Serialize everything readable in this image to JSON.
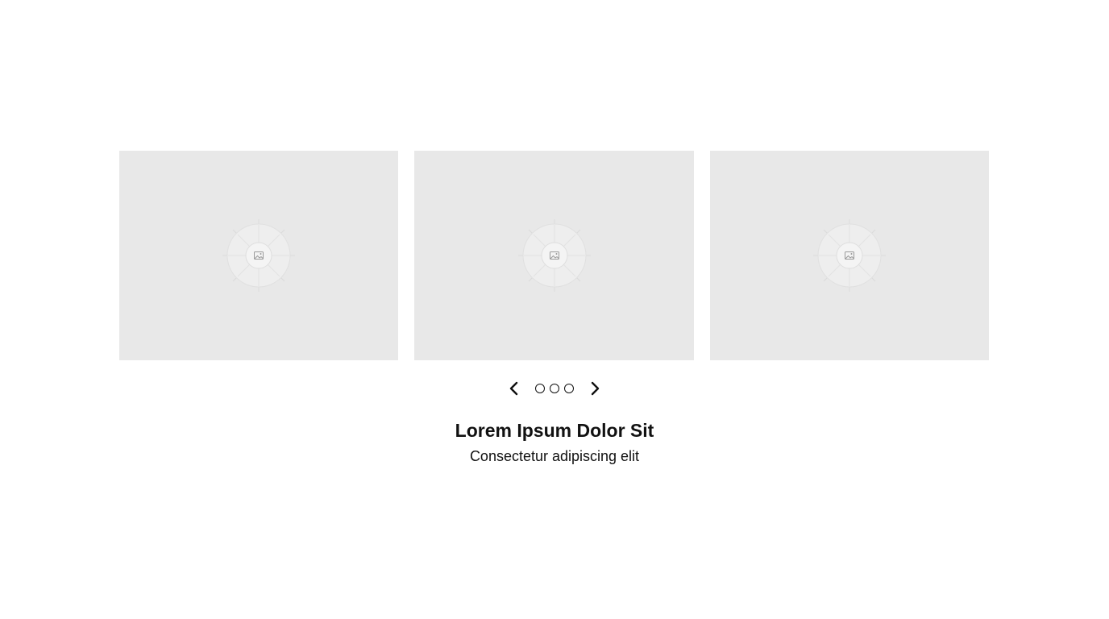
{
  "carousel": {
    "slides": [
      {
        "icon": "image-placeholder-icon"
      },
      {
        "icon": "image-placeholder-icon"
      },
      {
        "icon": "image-placeholder-icon"
      }
    ],
    "controls": {
      "prev_icon": "chevron-left-icon",
      "next_icon": "chevron-right-icon",
      "dot_count": 3
    },
    "caption": {
      "title": "Lorem Ipsum Dolor Sit",
      "subtitle": "Consectetur adipiscing elit"
    }
  },
  "colors": {
    "background": "#ffffff",
    "slide_fill": "#e8e8e8",
    "text": "#111111"
  }
}
